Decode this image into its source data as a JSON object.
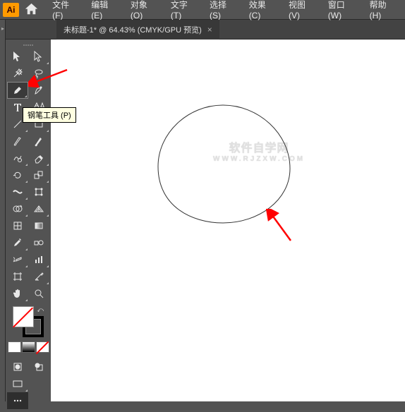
{
  "app": {
    "logo_text": "Ai"
  },
  "menu": {
    "items": [
      {
        "label": "文件(F)"
      },
      {
        "label": "编辑(E)"
      },
      {
        "label": "对象(O)"
      },
      {
        "label": "文字(T)"
      },
      {
        "label": "选择(S)"
      },
      {
        "label": "效果(C)"
      },
      {
        "label": "视图(V)"
      },
      {
        "label": "窗口(W)"
      },
      {
        "label": "帮助(H)"
      }
    ]
  },
  "tab": {
    "title": "未标题-1* @ 64.43% (CMYK/GPU 预览)",
    "close": "×"
  },
  "tooltip": {
    "text": "钢笔工具 (P)"
  },
  "watermark": {
    "line1": "软件自学网",
    "line2": "WWW.RJZXW.COM"
  },
  "tools": {
    "names": [
      "selection-tool",
      "direct-selection-tool",
      "magic-wand-tool",
      "lasso-tool",
      "pen-tool",
      "curvature-tool",
      "type-tool",
      "touch-type-tool",
      "line-tool",
      "rectangle-tool",
      "paintbrush-tool",
      "blob-brush-tool",
      "shaper-tool",
      "eraser-tool",
      "rotate-tool",
      "scale-tool",
      "width-tool",
      "free-transform-tool",
      "shape-builder-tool",
      "perspective-tool",
      "mesh-tool",
      "gradient-tool",
      "eyedropper-tool",
      "blend-tool",
      "symbol-sprayer-tool",
      "column-graph-tool",
      "artboard-tool",
      "slice-tool",
      "hand-tool",
      "zoom-tool"
    ]
  },
  "colors": {
    "accent": "#ff9a00",
    "fill": "none",
    "stroke": "#000000"
  }
}
